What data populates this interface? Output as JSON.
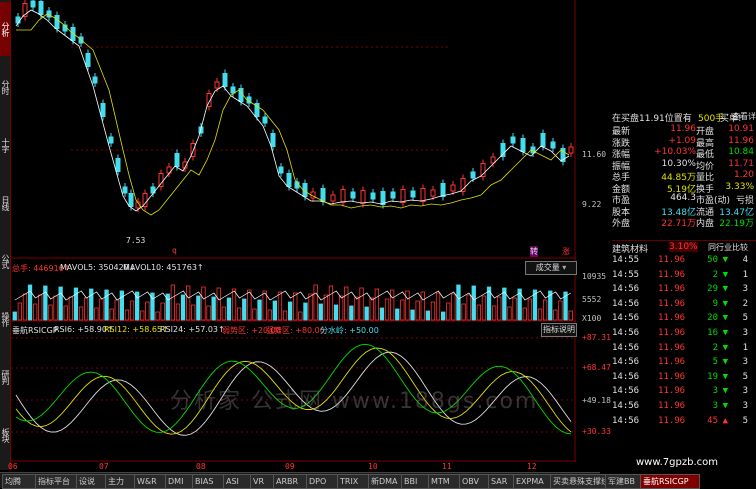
{
  "left_tabs": [
    "分析",
    "分时",
    "十字",
    "日线",
    "公式",
    "操作",
    "研判",
    "板块"
  ],
  "price_chart": {
    "y_labels": [
      {
        "text": "11.60",
        "color": "#c0c0c0"
      },
      {
        "text": "9.22",
        "color": "#c0c0c0"
      }
    ],
    "low_label": "7.53",
    "markers": [
      "q",
      "转",
      "涨"
    ],
    "colors": {
      "up": "#ff3333",
      "down": "#44ddee",
      "ma_white": "#ffffff",
      "ma_yellow": "#e0e000"
    }
  },
  "volume_header": {
    "total": "总手: 446916↑",
    "ma5": "MAVOL5: 350420↓",
    "ma10": "MAVOL10: 451763↑",
    "y_labels": [
      "10935",
      "5552",
      "X100"
    ],
    "dropdown": "成交量"
  },
  "rsi_header": {
    "name": "垂航RSICGP",
    "rsi6": "RSI6: +58.90↑",
    "rsi12": "RSI12: +58.65↑",
    "rsi24": "RSI24: +57.03↑",
    "weak": "弱势区: +20.00",
    "strong": "强势区: +80.00",
    "mid": "分水岭: +50.00",
    "button": "指标说明",
    "y_labels": [
      "+87.31",
      "+68.47",
      "+49.18",
      "+30.33"
    ]
  },
  "x_axis": [
    "06",
    "07",
    "08",
    "09",
    "10",
    "11",
    "12"
  ],
  "quote_header": {
    "title": "在买盘11.91位置有",
    "qty": "500手",
    "link1": "买单!",
    "link2": "查看详细"
  },
  "quote_rows": [
    {
      "l1": "最新",
      "v1": "11.96",
      "l2": "开盘",
      "v2": "10.91",
      "c1": "#ff3333",
      "c2": "#ff3333"
    },
    {
      "l1": "涨跌",
      "v1": "+1.09",
      "l2": "最高",
      "v2": "11.96",
      "c1": "#ff3333",
      "c2": "#ff3333"
    },
    {
      "l1": "涨幅",
      "v1": "+10.03%",
      "l2": "最低",
      "v2": "10.84",
      "c1": "#ff3333",
      "c2": "#00dd00"
    },
    {
      "l1": "振幅",
      "v1": "10.30%",
      "l2": "均价",
      "v2": "11.71",
      "c1": "#e0e0e0",
      "c2": "#ff3333"
    },
    {
      "l1": "总手",
      "v1": "44.85万",
      "l2": "量比",
      "v2": "1.20",
      "c1": "#e0e000",
      "c2": "#ff3333"
    },
    {
      "l1": "金额",
      "v1": "5.19亿",
      "l2": "换手",
      "v2": "3.33%",
      "c1": "#e0e000",
      "c2": "#e0e000"
    },
    {
      "l1": "市盈",
      "v1": "464.3",
      "l2": "市盈(动)",
      "v2": "亏损",
      "c1": "#e0e0e0",
      "c2": "#e0e0e0"
    },
    {
      "l1": "股本",
      "v1": "13.48亿",
      "l2": "流通",
      "v2": "13.47亿",
      "c1": "#44ddee",
      "c2": "#44ddee"
    },
    {
      "l1": "外盘",
      "v1": "22.71万",
      "l2": "内盘",
      "v2": "22.19万",
      "c1": "#ff3333",
      "c2": "#00dd00"
    }
  ],
  "sector": {
    "name": "建筑材料",
    "pct": "3.10%",
    "button": "同行业比较"
  },
  "trades": [
    {
      "time": "14:55",
      "price": "11.96",
      "vol": "50",
      "arrow": "▼",
      "n": "4",
      "vc": "#00dd00"
    },
    {
      "time": "14:55",
      "price": "11.96",
      "vol": "2",
      "arrow": "▼",
      "n": "1",
      "vc": "#00dd00"
    },
    {
      "time": "14:56",
      "price": "11.96",
      "vol": "29",
      "arrow": "▼",
      "n": "3",
      "vc": "#00dd00"
    },
    {
      "time": "14:56",
      "price": "11.96",
      "vol": "9",
      "arrow": "▼",
      "n": "2",
      "vc": "#00dd00"
    },
    {
      "time": "14:56",
      "price": "11.96",
      "vol": "20",
      "arrow": "▼",
      "n": "5",
      "vc": "#00dd00"
    },
    {
      "time": "14:56",
      "price": "11.96",
      "vol": "16",
      "arrow": "▼",
      "n": "3",
      "vc": "#00dd00"
    },
    {
      "time": "14:56",
      "price": "11.96",
      "vol": "2",
      "arrow": "▼",
      "n": "1",
      "vc": "#00dd00"
    },
    {
      "time": "14:56",
      "price": "11.96",
      "vol": "5",
      "arrow": "▼",
      "n": "3",
      "vc": "#00dd00"
    },
    {
      "time": "14:56",
      "price": "11.96",
      "vol": "19",
      "arrow": "▼",
      "n": "5",
      "vc": "#00dd00"
    },
    {
      "time": "14:56",
      "price": "11.96",
      "vol": "3",
      "arrow": "▼",
      "n": "3",
      "vc": "#00dd00"
    },
    {
      "time": "14:56",
      "price": "11.96",
      "vol": "3",
      "arrow": "▼",
      "n": "3",
      "vc": "#00dd00"
    },
    {
      "time": "14:56",
      "price": "11.96",
      "vol": "45",
      "arrow": "▲",
      "n": "5",
      "vc": "#ff3333"
    }
  ],
  "bottom_tabs": [
    "均腾",
    "指标平台",
    "设说",
    "主力",
    "W&R",
    "DMI",
    "BIAS",
    "ASI",
    "VR",
    "ARBR",
    "DPO",
    "TRIX",
    "新DMA",
    "BBI",
    "MTM",
    "OBV",
    "SAR",
    "EXPMA",
    "买卖悬殊支撑线",
    "军建BB",
    "垂航RSICGP"
  ],
  "watermark": "分析家 公式网 www.188gs.com",
  "site_mark": "www.7gpzb.com"
}
